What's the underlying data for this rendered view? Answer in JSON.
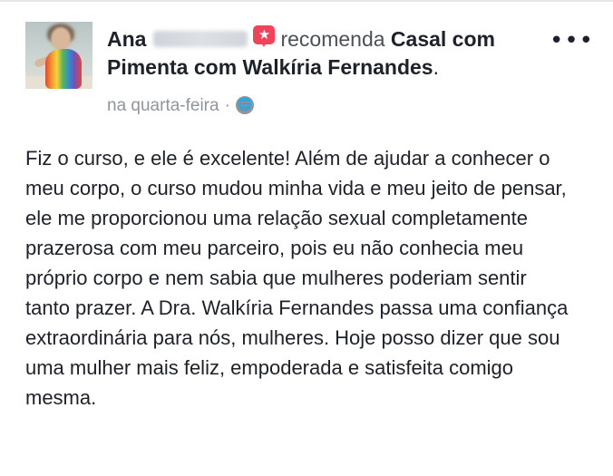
{
  "post": {
    "author_first_name": "Ana",
    "verb": "recomenda",
    "page_name": "Casal com Pimenta com Walkíria Fernandes",
    "punctuation": ".",
    "timestamp": "na quarta-feira",
    "separator": "·",
    "privacy_icon": "globe-icon",
    "recommend_icon": "star-bubble-icon",
    "recommend_symbol": "★",
    "more_icon": "more-options-icon",
    "more_symbol": "•••",
    "globe_symbol": "🌐",
    "body": "Fiz o curso, e ele é excelente! Além de ajudar a conhecer o meu corpo, o curso mudou minha vida e meu jeito de pensar, ele me proporcionou uma relação sexual completamente prazerosa com meu parceiro, pois eu não conhecia meu próprio corpo e nem sabia que mulheres poderiam sentir tanto prazer. A Dra. Walkíria Fernandes passa uma confiança extraordinária para nós, mulheres. Hoje posso dizer que sou uma mulher mais feliz, empoderada e satisfeita comigo mesma."
  },
  "colors": {
    "recommend_red": "#f2425a",
    "meta_gray": "#90949c",
    "text": "#1d2129"
  }
}
